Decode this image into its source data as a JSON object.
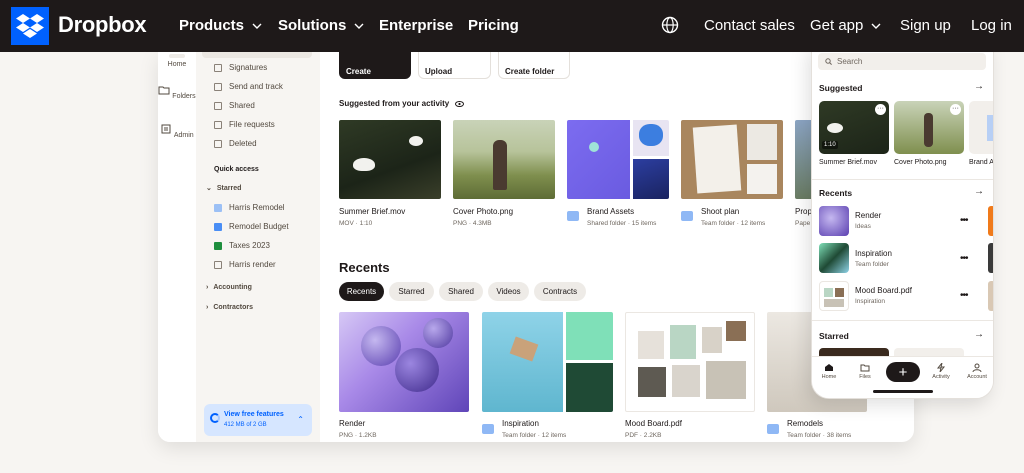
{
  "nav": {
    "brand": "Dropbox",
    "products": "Products",
    "solutions": "Solutions",
    "enterprise": "Enterprise",
    "pricing": "Pricing",
    "contact_sales": "Contact sales",
    "get_app": "Get app",
    "sign_up": "Sign up",
    "log_in": "Log in"
  },
  "rail": {
    "home": "Home",
    "folders": "Folders",
    "admin": "Admin"
  },
  "sidebar": {
    "items": [
      "Signatures",
      "Send and track",
      "Shared",
      "File requests",
      "Deleted"
    ],
    "quick_access": "Quick access",
    "starred": "Starred",
    "starred_items": [
      "Harris Remodel",
      "Remodel Budget",
      "Taxes 2023",
      "Harris render"
    ],
    "accounting": "Accounting",
    "contractors": "Contractors",
    "promo_title": "View free features",
    "promo_sub": "412 MB of 2 GB"
  },
  "actions": {
    "create": "Create",
    "upload": "Upload",
    "create_folder": "Create folder"
  },
  "suggested": {
    "title": "Suggested from your activity",
    "cards": [
      {
        "name": "Summer Brief.mov",
        "meta": "MOV · 1:10"
      },
      {
        "name": "Cover Photo.png",
        "meta": "PNG · 4.3MB"
      },
      {
        "name": "Brand Assets",
        "meta": "Shared folder · 15 items"
      },
      {
        "name": "Shoot plan",
        "meta": "Team folder · 12 items"
      },
      {
        "name": "Prop",
        "meta": "Pape"
      }
    ]
  },
  "recents": {
    "title": "Recents",
    "chips": [
      "Recents",
      "Starred",
      "Shared",
      "Videos",
      "Contracts"
    ],
    "cards": [
      {
        "name": "Render",
        "meta": "PNG · 1.2KB"
      },
      {
        "name": "Inspiration",
        "meta": "Team folder · 12 items"
      },
      {
        "name": "Mood Board.pdf",
        "meta": "PDF · 2.2KB"
      },
      {
        "name": "Remodels",
        "meta": "Team folder · 38 items"
      }
    ]
  },
  "phone": {
    "search_placeholder": "Search",
    "suggested": "Suggested",
    "suggested_items": [
      "Summer Brief.mov",
      "Cover Photo.png",
      "Brand A"
    ],
    "video_badge": "1:10",
    "recents": "Recents",
    "recent_items": [
      {
        "name": "Render",
        "sub": "Ideas"
      },
      {
        "name": "Inspiration",
        "sub": "Team folder"
      },
      {
        "name": "Mood Board.pdf",
        "sub": "Inspiration"
      }
    ],
    "starred": "Starred",
    "tabs": [
      "Home",
      "Files",
      "Activity",
      "Account"
    ]
  },
  "colors": {
    "brand_blue": "#0061fe",
    "nav_bg": "#1e1919",
    "page_bg": "#f7f5f2"
  }
}
